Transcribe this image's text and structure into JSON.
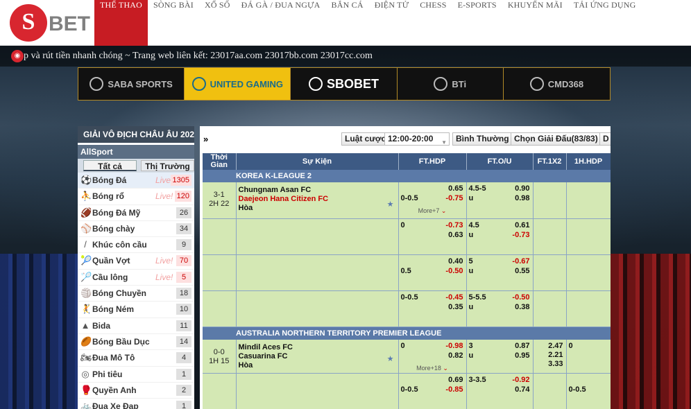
{
  "header": {
    "logo_mark": "S",
    "logo_text": "BET",
    "nav": [
      {
        "label": "THỂ THAO",
        "active": true
      },
      {
        "label": "SÒNG BÀI"
      },
      {
        "label": "XỔ SỐ"
      },
      {
        "label": "ĐÁ GÀ / ĐUA NGỰA"
      },
      {
        "label": "BẮN CÁ"
      },
      {
        "label": "ĐIỆN TỬ"
      },
      {
        "label": "CHESS"
      },
      {
        "label": "E-SPORTS"
      },
      {
        "label": "KHUYẾN MÃI"
      },
      {
        "label": "TẢI ỨNG DỤNG"
      }
    ]
  },
  "ticker": {
    "text": "p và rút tiền nhanh chóng ~ Trang web liên kết: 23017aa.com 23017bb.com 23017cc.com"
  },
  "providers": [
    "SABA SPORTS",
    "UNITED GAMING",
    "SBOBET",
    "BTi",
    "CMD368"
  ],
  "sidebar": {
    "league_title": "GIẢI VÔ ĐỊCH CHÂU ÂU 202",
    "allsport": "AllSport",
    "tab_all": "Tất cả",
    "tab_market": "Thị Trường",
    "sports": [
      {
        "name": "Bóng Đá",
        "live": "Live!",
        "count": "1305",
        "icon": "⚽"
      },
      {
        "name": "Bóng rổ",
        "live": "Live!",
        "count": "120",
        "icon": "⛹"
      },
      {
        "name": "Bóng Đá Mỹ",
        "live": "",
        "count": "26",
        "icon": "🏈"
      },
      {
        "name": "Bóng chày",
        "live": "",
        "count": "34",
        "icon": "⚾"
      },
      {
        "name": "Khúc côn cầu",
        "live": "",
        "count": "9",
        "icon": "/"
      },
      {
        "name": "Quần Vợt",
        "live": "Live!",
        "count": "70",
        "icon": "🎾"
      },
      {
        "name": "Cầu lông",
        "live": "Live!",
        "count": "5",
        "icon": "🏸"
      },
      {
        "name": "Bóng Chuyền",
        "live": "",
        "count": "18",
        "icon": "🏐"
      },
      {
        "name": "Bóng Ném",
        "live": "",
        "count": "10",
        "icon": "🤾"
      },
      {
        "name": "Bida",
        "live": "",
        "count": "11",
        "icon": "▲"
      },
      {
        "name": "Bóng Bầu Dục",
        "live": "",
        "count": "14",
        "icon": "🏉"
      },
      {
        "name": "Đua Mô Tô",
        "live": "",
        "count": "4",
        "icon": "🏍"
      },
      {
        "name": "Phi tiêu",
        "live": "",
        "count": "1",
        "icon": "◎"
      },
      {
        "name": "Quyền Anh",
        "live": "",
        "count": "2",
        "icon": "🥊"
      },
      {
        "name": "Đua Xe Đạp",
        "live": "",
        "count": "1",
        "icon": "🚲"
      }
    ]
  },
  "toolbar": {
    "arrow": "»",
    "rules": "Luật cược",
    "time_select": "12:00-20:00",
    "mode": "Bình Thường",
    "league_pick": "Chọn Giải Đấu(83/83)",
    "extra": "D"
  },
  "table": {
    "headers": [
      "Thời Gian",
      "Sự Kiện",
      "FT.HDP",
      "FT.O/U",
      "FT.1X2",
      "1H.HDP"
    ],
    "leagues": [
      {
        "name": "KOREA K-LEAGUE 2",
        "match": {
          "score": "3-1",
          "time": "2H 22",
          "home": "Chungnam Asan FC",
          "away": "Daejeon Hana Citizen FC",
          "draw": "Hòa",
          "away_red": true
        },
        "rows": [
          {
            "hdp_line": "0-0.5",
            "hdp_line_pos": "bottom",
            "hdp_top": "0.65",
            "hdp_bot": "-0.75",
            "ou_line": "4.5-5",
            "ou_u": "u",
            "ou_top": "0.90",
            "ou_bot": "0.98",
            "more": "More+7"
          },
          {
            "hdp_line": "0",
            "hdp_line_pos": "top",
            "hdp_top": "-0.73",
            "hdp_bot": "0.63",
            "ou_line": "4.5",
            "ou_u": "u",
            "ou_top": "0.61",
            "ou_bot": "-0.73"
          },
          {
            "hdp_line": "0.5",
            "hdp_line_pos": "bottom",
            "hdp_top": "0.40",
            "hdp_bot": "-0.50",
            "ou_line": "5",
            "ou_u": "u",
            "ou_top": "-0.67",
            "ou_bot": "0.55"
          },
          {
            "hdp_line": "0-0.5",
            "hdp_line_pos": "top",
            "hdp_top": "-0.45",
            "hdp_bot": "0.35",
            "ou_line": "5-5.5",
            "ou_u": "u",
            "ou_top": "-0.50",
            "ou_bot": "0.38"
          }
        ]
      },
      {
        "name": "AUSTRALIA NORTHERN TERRITORY PREMIER LEAGUE",
        "match": {
          "score": "0-0",
          "time": "1H 15",
          "home": "Mindil Aces FC",
          "away": "Casuarina FC",
          "draw": "Hòa",
          "away_red": false
        },
        "x12": [
          "2.47",
          "2.21",
          "3.33"
        ],
        "h1": "0",
        "rows": [
          {
            "hdp_line": "0",
            "hdp_line_pos": "top",
            "hdp_top": "-0.98",
            "hdp_bot": "0.82",
            "ou_line": "3",
            "ou_u": "u",
            "ou_top": "0.87",
            "ou_bot": "0.95",
            "more": "More+18"
          },
          {
            "hdp_line": "0-0.5",
            "hdp_line_pos": "bottom",
            "hdp_top": "0.69",
            "hdp_bot": "-0.85",
            "ou_line": "3-3.5",
            "ou_u": "",
            "ou_top": "-0.92",
            "ou_bot": "0.74",
            "h1": "0-0.5"
          }
        ]
      }
    ]
  }
}
